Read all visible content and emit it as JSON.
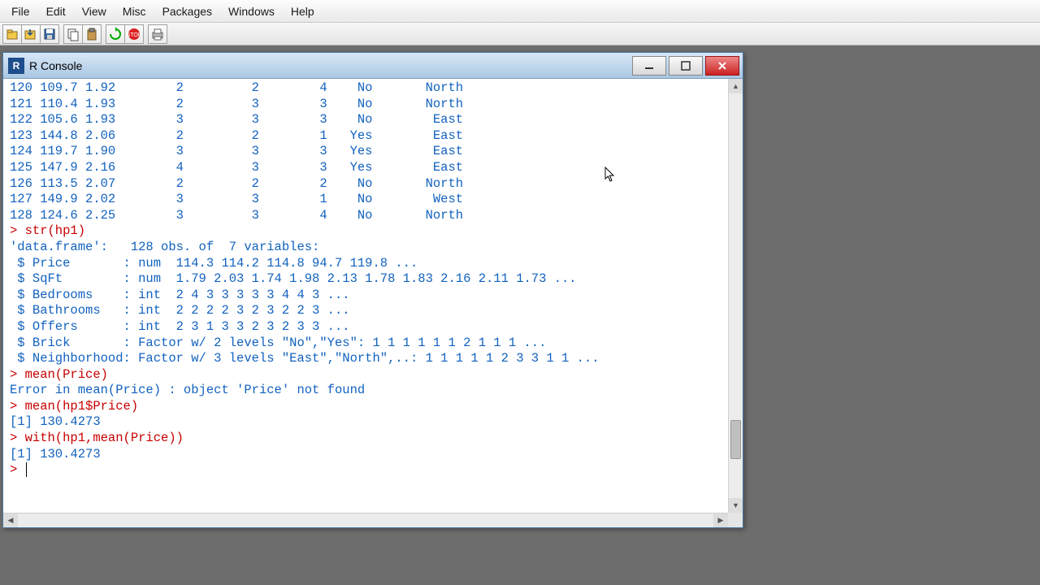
{
  "menu": [
    "File",
    "Edit",
    "View",
    "Misc",
    "Packages",
    "Windows",
    "Help"
  ],
  "toolbar_icons": [
    "open",
    "load-workspace",
    "save",
    "copy",
    "paste",
    "refresh",
    "stop",
    "print"
  ],
  "window": {
    "title": "R Console"
  },
  "console_lines": [
    {
      "cls": "out",
      "text": "120 109.7 1.92        2         2        4    No       North"
    },
    {
      "cls": "out",
      "text": "121 110.4 1.93        2         3        3    No       North"
    },
    {
      "cls": "out",
      "text": "122 105.6 1.93        3         3        3    No        East"
    },
    {
      "cls": "out",
      "text": "123 144.8 2.06        2         2        1   Yes        East"
    },
    {
      "cls": "out",
      "text": "124 119.7 1.90        3         3        3   Yes        East"
    },
    {
      "cls": "out",
      "text": "125 147.9 2.16        4         3        3   Yes        East"
    },
    {
      "cls": "out",
      "text": "126 113.5 2.07        2         2        2    No       North"
    },
    {
      "cls": "out",
      "text": "127 149.9 2.02        3         3        1    No        West"
    },
    {
      "cls": "out",
      "text": "128 124.6 2.25        3         3        4    No       North"
    },
    {
      "cls": "cmd",
      "text": "> str(hp1)"
    },
    {
      "cls": "out",
      "text": "'data.frame':   128 obs. of  7 variables:"
    },
    {
      "cls": "out",
      "text": " $ Price       : num  114.3 114.2 114.8 94.7 119.8 ..."
    },
    {
      "cls": "out",
      "text": " $ SqFt        : num  1.79 2.03 1.74 1.98 2.13 1.78 1.83 2.16 2.11 1.73 ..."
    },
    {
      "cls": "out",
      "text": " $ Bedrooms    : int  2 4 3 3 3 3 3 4 4 3 ..."
    },
    {
      "cls": "out",
      "text": " $ Bathrooms   : int  2 2 2 2 3 2 3 2 2 3 ..."
    },
    {
      "cls": "out",
      "text": " $ Offers      : int  2 3 1 3 3 2 3 2 3 3 ..."
    },
    {
      "cls": "out",
      "text": " $ Brick       : Factor w/ 2 levels \"No\",\"Yes\": 1 1 1 1 1 1 2 1 1 1 ..."
    },
    {
      "cls": "out",
      "text": " $ Neighborhood: Factor w/ 3 levels \"East\",\"North\",..: 1 1 1 1 1 2 3 3 1 1 ..."
    },
    {
      "cls": "cmd",
      "text": "> mean(Price)"
    },
    {
      "cls": "out",
      "text": "Error in mean(Price) : object 'Price' not found"
    },
    {
      "cls": "cmd",
      "text": "> mean(hp1$Price)"
    },
    {
      "cls": "out",
      "text": "[1] 130.4273"
    },
    {
      "cls": "cmd",
      "text": "> with(hp1,mean(Price))"
    },
    {
      "cls": "out",
      "text": "[1] 130.4273"
    },
    {
      "cls": "cmd",
      "text": "> "
    }
  ]
}
